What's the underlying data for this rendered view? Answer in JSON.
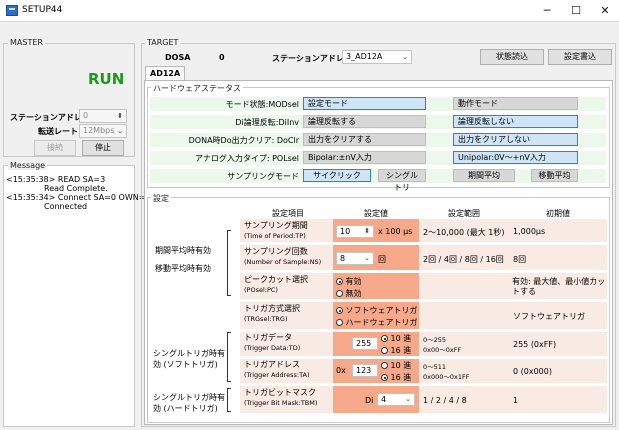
{
  "window": {
    "title": "SETUP44"
  },
  "master": {
    "label": "MASTER",
    "status": "RUN",
    "station_label": "ステーションアドレス",
    "station_value": "0",
    "rate_label": "転送レート",
    "rate_value": "12Mbps",
    "connect_label": "接続",
    "stop_label": "停止"
  },
  "message": {
    "label": "Message",
    "lines": [
      "<15:35:38> READ SA=3",
      "Read Complete.",
      "<15:35:34> Connect SA=0 OWN=1",
      "Connected"
    ]
  },
  "target": {
    "label": "TARGET",
    "device_name": "DOSA",
    "device_value": "0",
    "station_label": "ステーションアドレス",
    "station_value": "3_AD12A",
    "read_status_label": "状態読込",
    "write_settings_label": "設定書込",
    "tab_label": "AD12A"
  },
  "hardware_status": {
    "label": "ハードウェアステータス",
    "rows": [
      {
        "label": "モード状態:MODsel",
        "left": "設定モード",
        "right": "動作モード"
      },
      {
        "label": "Di論理反転:DiInv",
        "left": "論理反転する",
        "right": "論理反転しない"
      },
      {
        "label": "DONA時Do出力クリア: DoClr",
        "left": "出力をクリアする",
        "right": "出力をクリアしない"
      },
      {
        "label": "アナログ入力タイプ: POLsel",
        "left": "Bipolar:±nV入力",
        "right": "Unipolar:0V〜+nV入力"
      }
    ],
    "sampling_label": "サンプリングモード",
    "sampling_modes": [
      "サイクリック",
      "シングルトリ",
      "期間平均",
      "移動平均"
    ]
  },
  "settings": {
    "label": "設定",
    "headers": {
      "item": "設定項目",
      "value": "設定値",
      "range": "設定範囲",
      "initial": "初期値"
    },
    "group1": [
      "期間平均時有効",
      "移動平均時有効"
    ],
    "group2": [
      "シングルトリガ時有",
      "効 (ソフトトリガ)"
    ],
    "group3": [
      "シングルトリガ時有",
      "効 (ハードトリガ)"
    ],
    "rows": {
      "sampling_period": {
        "name": "サンプリング期間",
        "sub": "(Time of Period:TP)",
        "value": "10",
        "unit": "x 100 μs",
        "range": "2〜10,000 (最大 1秒)",
        "initial": "1,000μs"
      },
      "sampling_count": {
        "name": "サンプリング回数",
        "sub": "(Number of Sample:NS)",
        "value": "8",
        "unit": "回",
        "range": "2回 / 4回 / 8回 / 16回",
        "initial": "8回"
      },
      "peak_cut": {
        "name": "ピークカット選択",
        "sub": "(POsel:PC)",
        "opt_on": "有効",
        "opt_off": "無効",
        "initial": "有効: 最大値、最小値カットする"
      },
      "trigger_mode": {
        "name": "トリガ方式選択",
        "sub": "(TRGsel:TRG)",
        "opt_soft": "ソフトウェアトリガ",
        "opt_hard": "ハードウェアトリガ",
        "initial": "ソフトウェアトリガ"
      },
      "trigger_data": {
        "name": "トリガデータ",
        "sub": "(Trigger Data:TD)",
        "value": "255",
        "opt_dec": "10 進",
        "opt_hex": "16 進",
        "range1": "0〜255",
        "range2": "0x00〜0xFF",
        "initial": "255 (0xFF)"
      },
      "trigger_address": {
        "name": "トリガアドレス",
        "sub": "(Trigger Address:TA)",
        "prefix": "0x",
        "value": "123",
        "opt_dec": "10 進",
        "opt_hex": "16 進",
        "range1": "0〜511",
        "range2": "0x000〜0x1FF",
        "initial": "0 (0x000)"
      },
      "trigger_bitmask": {
        "name": "トリガビットマスク",
        "sub": "(Trigger Bit Mask:TBM)",
        "prefix": "Di",
        "value": "4",
        "range": "1 / 2 / 4 / 8",
        "initial": "1"
      }
    }
  }
}
